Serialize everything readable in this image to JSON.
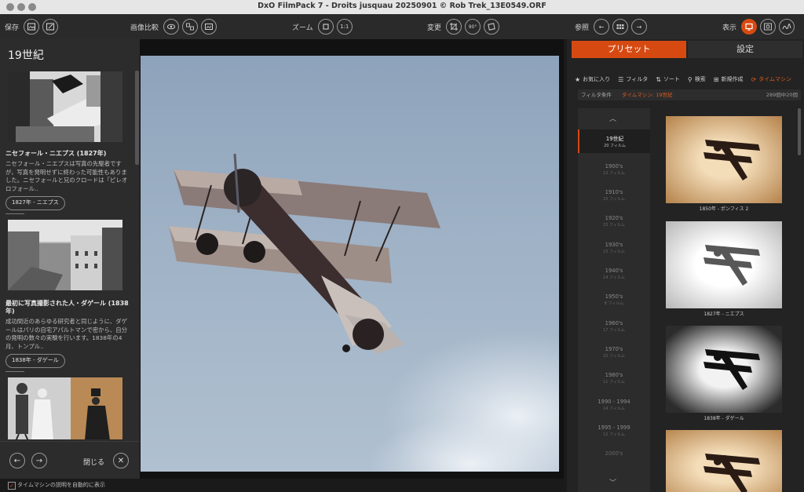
{
  "window": {
    "title": "DxO FilmPack 7 - Droits jusquau 20250901 © Rob Trek_13E0549.ORF"
  },
  "toolbar": {
    "save_label": "保存",
    "compare_label": "画像比較",
    "zoom_label": "ズーム",
    "zoom_fit_icon": "fit-icon",
    "zoom_1to1": "1:1",
    "transform_label": "変更",
    "rotate_90": "90°",
    "browse_label": "参照",
    "display_label": "表示"
  },
  "left_panel": {
    "title": "19世紀",
    "entries": [
      {
        "heading": "ニセフォール・ニエプス (1827年)",
        "body": "ニセフォール・ニエプスは写真の先駆者ですが，写真を発明せずに終わった可能性もありました。ニセフォールと兄のクロードは「ピレオロフォール..",
        "pill": "1827年 - ニエプス"
      },
      {
        "heading": "最初に写真撮影された人・ダゲール (1838年)",
        "body": "成功間近のあらゆる研究者と同じように、ダゲールはパリの自宅アパルトマンで密から、自分の発明の数々の実験を行います。1838年の4月、トンプル..",
        "pill": "1838年 - ダゲール"
      }
    ],
    "close_label": "閉じる"
  },
  "bottom": {
    "auto_show_label": "タイムマシンの説明を自動的に表示",
    "auto_show_checked": true
  },
  "right_panel": {
    "tabs": [
      "プリセット",
      "設定"
    ],
    "tools": {
      "favorites": "お気に入り",
      "filter": "フィルタ",
      "sort": "ソート",
      "search": "検索",
      "new": "新規作成",
      "time_machine": "タイムマシン"
    },
    "filter_bar": {
      "label": "フィルタ条件",
      "value": "タイムマシン: 19世紀",
      "count": "289個中20個"
    },
    "eras": [
      {
        "name": "19世紀",
        "count": "20 フィルム",
        "active": true
      },
      {
        "name": "1900's",
        "count": "13 フィルム"
      },
      {
        "name": "1910's",
        "count": "15 フィルム"
      },
      {
        "name": "1920's",
        "count": "15 フィルム"
      },
      {
        "name": "1930's",
        "count": "15 フィルム"
      },
      {
        "name": "1940's",
        "count": "14 フィルム"
      },
      {
        "name": "1950's",
        "count": "8 フィルム"
      },
      {
        "name": "1960's",
        "count": "17 フィルム"
      },
      {
        "name": "1970's",
        "count": "22 フィルム"
      },
      {
        "name": "1980's",
        "count": "11 フィルム"
      },
      {
        "name": "1990 - 1994",
        "count": "14 フィルム"
      },
      {
        "name": "1995 - 1999",
        "count": "12 フィルム"
      },
      {
        "name": "2000's",
        "count": ""
      }
    ],
    "presets": [
      {
        "caption": "1850年 - ポンフィス 2",
        "tone": "sepia"
      },
      {
        "caption": "1827年 - ニエプス",
        "tone": "white"
      },
      {
        "caption": "1838年 - ダゲール",
        "tone": "vignette"
      },
      {
        "caption": "",
        "tone": "sepia"
      }
    ]
  },
  "colors": {
    "accent": "#d64a12",
    "panel": "#2c2c2c",
    "toolbar": "#2a2a2a"
  },
  "icons": [
    "save-icon",
    "export-icon",
    "eye-icon",
    "compare-split-icon",
    "compare-side-icon",
    "crop-icon",
    "rotate-icon",
    "straighten-icon",
    "prev-icon",
    "grid-icon",
    "next-icon",
    "fullscreen-icon",
    "loupe-icon",
    "histogram-icon",
    "star-icon",
    "filter-icon",
    "sort-icon",
    "search-icon",
    "new-preset-icon",
    "time-machine-icon",
    "chevron-up-icon",
    "chevron-down-icon",
    "close-icon"
  ]
}
